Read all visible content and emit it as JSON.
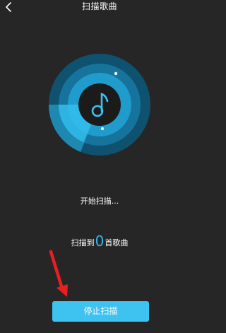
{
  "header": {
    "title": "扫描歌曲",
    "back_icon": "chevron-left-icon"
  },
  "scan": {
    "status_text": "开始扫描...",
    "count_prefix": "扫描到",
    "count_value": "0",
    "count_suffix": "首歌曲"
  },
  "actions": {
    "stop_label": "停止扫描"
  },
  "colors": {
    "accent": "#3ec2f0",
    "background": "#262626",
    "count_color": "#33b6e8"
  }
}
